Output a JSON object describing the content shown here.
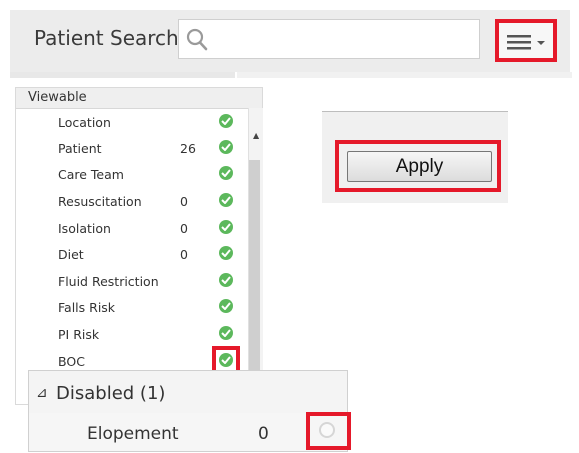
{
  "search": {
    "label": "Patient Search:",
    "value": "",
    "placeholder": "",
    "icon": "search-icon",
    "menu_icon": "hamburger-menu-icon"
  },
  "viewable": {
    "header": "Viewable",
    "rows": [
      {
        "label": "Location",
        "count": "",
        "status": "enabled"
      },
      {
        "label": "Patient",
        "count": "26",
        "status": "enabled"
      },
      {
        "label": "Care Team",
        "count": "",
        "status": "enabled"
      },
      {
        "label": "Resuscitation",
        "count": "0",
        "status": "enabled"
      },
      {
        "label": "Isolation",
        "count": "0",
        "status": "enabled"
      },
      {
        "label": "Diet",
        "count": "0",
        "status": "enabled"
      },
      {
        "label": "Fluid Restriction",
        "count": "",
        "status": "enabled"
      },
      {
        "label": "Falls Risk",
        "count": "",
        "status": "enabled"
      },
      {
        "label": "PI Risk",
        "count": "",
        "status": "enabled"
      },
      {
        "label": "BOC",
        "count": "",
        "status": "enabled"
      }
    ]
  },
  "apply": {
    "label": "Apply"
  },
  "disabled": {
    "toggle_glyph": "⊿",
    "title": "Disabled (1)",
    "rows": [
      {
        "label": "Elopement",
        "count": "0",
        "status": "disabled"
      }
    ]
  },
  "colors": {
    "highlight": "#e5192a",
    "check": "#5cb85c"
  }
}
